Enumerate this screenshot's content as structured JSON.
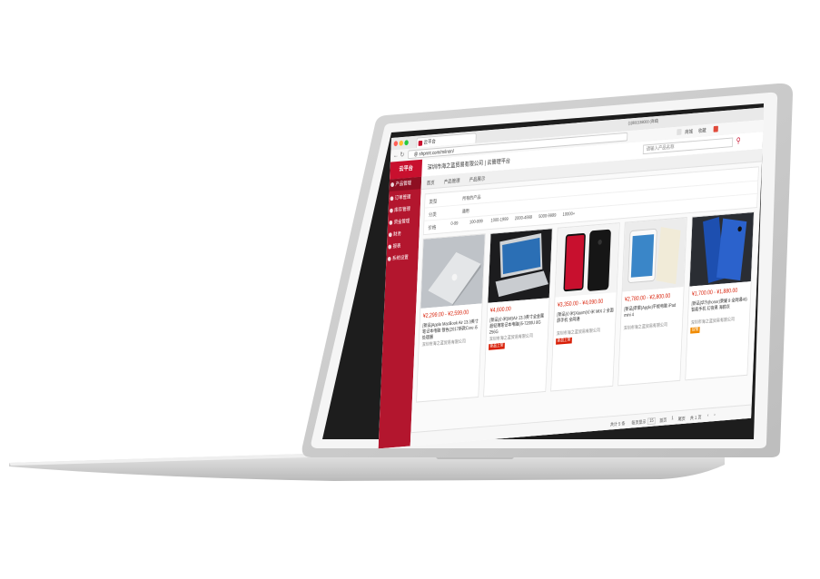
{
  "browser": {
    "tab_title": "云平台",
    "url": "@ shpnnt.com/m/inon/",
    "top_right_phone": "(1)800138000 (商城)",
    "toolbar_right": [
      "商城",
      "收藏"
    ]
  },
  "site": {
    "logo_text": "云平台",
    "company": "深圳市海之蓝贸易有限公司 | 云管理平台",
    "search_placeholder": "请输入产品名称"
  },
  "sidebar": {
    "items": [
      {
        "label": "产品管理",
        "active": true
      },
      {
        "label": "订单管理",
        "active": false
      },
      {
        "label": "库存管理",
        "active": false
      },
      {
        "label": "资金管理",
        "active": false
      },
      {
        "label": "财务",
        "active": false
      },
      {
        "label": "报表",
        "active": false
      },
      {
        "label": "系统设置",
        "active": false
      }
    ]
  },
  "breadcrumb": [
    "首页",
    "产品管理",
    "产品展示"
  ],
  "filters": {
    "row1": {
      "label": "类型",
      "options": [
        "所有的产品"
      ]
    },
    "row2": {
      "label": "分类",
      "options": [
        "通用"
      ]
    },
    "row3": {
      "label": "价格",
      "options": [
        "0-99",
        "100-999",
        "1000-1999",
        "2000-4999",
        "5000-9999",
        "10000+"
      ]
    }
  },
  "products": [
    {
      "price": "¥2,299.00 - ¥2,599.00",
      "name": "[新品]Apple MacBook Air 13.3英寸笔记本电脑 银色(2017新款Core i5 处理器",
      "shop": "深圳市海之蓝贸易有限公司",
      "badge": "",
      "badge_color": "#d81e06"
    },
    {
      "price": "¥4,600.00",
      "name": "[新品]小米(MI)Air 13.3英寸全金属超轻薄笔记本电脑(i5-7200U 8G 256G",
      "shop": "深圳市海之蓝贸易有限公司",
      "badge": "新品上架",
      "badge_color": "#d81e06"
    },
    {
      "price": "¥3,350.00 - ¥4,090.00",
      "name": "[新品]小米(Xiaomi)小米 MIX 2 全面屏手机 全网通",
      "shop": "深圳市海之蓝贸易有限公司",
      "badge": "新品上架",
      "badge_color": "#d81e06"
    },
    {
      "price": "¥2,780.00 - ¥2,800.00",
      "name": "[新品]苹果(Apple)平板电脑 iPad mini 4",
      "shop": "深圳市海之蓝贸易有限公司",
      "badge": "",
      "badge_color": "#d81e06"
    },
    {
      "price": "¥1,700.00 - ¥1,880.00",
      "name": "[新品]华为(honor)荣耀 9 全网通4G智能手机 幻夜黑 海鸥灰",
      "shop": "深圳市海之蓝贸易有限公司",
      "badge": "促销",
      "badge_color": "#f08a00"
    }
  ],
  "pager": {
    "total": "共计 5 条",
    "per_page": "每页显示",
    "per_page_value": "15",
    "first": "首页",
    "page_info": "1",
    "last": "尾页",
    "pages": "共 1 页"
  },
  "colors": {
    "brand": "#b3162e",
    "price": "#d81e06"
  }
}
